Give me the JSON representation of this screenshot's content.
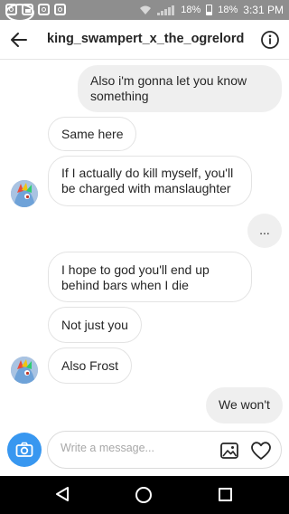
{
  "status_bar": {
    "battery_percent_a": "18%",
    "battery_percent_b": "18%",
    "time": "3:31 PM",
    "icons": [
      "instagram-icon",
      "image-icon",
      "instagram-icon",
      "instagram-icon",
      "chat-icon",
      "wifi-icon",
      "signal-icon",
      "battery-icon"
    ]
  },
  "header": {
    "title": "king_swampert_x_the_ogrelord",
    "back_icon": "arrow-left-icon",
    "info_icon": "info-icon"
  },
  "messages": [
    {
      "side": "sent",
      "text": "Also i'm gonna let you know something"
    },
    {
      "side": "received",
      "text": "Same here"
    },
    {
      "side": "received",
      "text": "If I actually do kill myself, you'll be charged with manslaughter"
    },
    {
      "side": "sent",
      "text": "..."
    },
    {
      "side": "received",
      "text": "I hope to god you'll end up behind bars when I die"
    },
    {
      "side": "received",
      "text": "Not just you"
    },
    {
      "side": "received",
      "text": "Also Frost"
    },
    {
      "side": "sent",
      "text": "We won't"
    }
  ],
  "composer": {
    "placeholder": "Write a message...",
    "value": ""
  },
  "colors": {
    "accent": "#3897f0",
    "sent_bubble": "#efefef",
    "status_bar": "#8e8e8e",
    "nav_bar": "#000000"
  }
}
